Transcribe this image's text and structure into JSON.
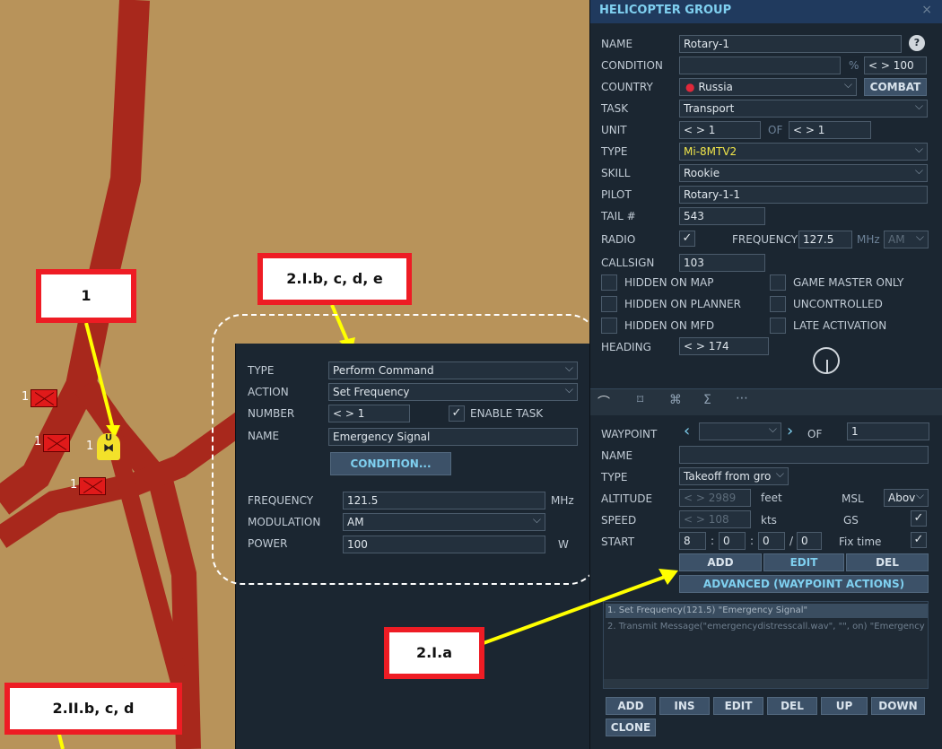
{
  "map": {
    "callouts": [
      "1",
      "2.I.b, c, d, e",
      "2.I.a",
      "2.II.b, c, d"
    ],
    "unit_counts": [
      "1",
      "1",
      "1",
      "1"
    ],
    "helo_letter": "U"
  },
  "trigger": {
    "type_label": "TYPE",
    "type_value": "Perform Command",
    "action_label": "ACTION",
    "action_value": "Set Frequency",
    "number_label": "NUMBER",
    "number_value": "< > 1",
    "enable_task": "ENABLE TASK",
    "name_label": "NAME",
    "name_value": "Emergency Signal",
    "condition_button": "CONDITION...",
    "frequency_label": "FREQUENCY",
    "frequency_value": "121.5",
    "frequency_unit": "MHz",
    "modulation_label": "MODULATION",
    "modulation_value": "AM",
    "power_label": "POWER",
    "power_value": "100",
    "power_unit": "W"
  },
  "group": {
    "title": "HELICOPTER GROUP",
    "close": "×",
    "name_label": "NAME",
    "name_value": "Rotary-1",
    "help": "?",
    "condition_label": "CONDITION",
    "condition_value": "",
    "percent": "%",
    "condition_pct": "< > 100",
    "country_label": "COUNTRY",
    "country_value": "Russia",
    "combat_button": "COMBAT",
    "task_label": "TASK",
    "task_value": "Transport",
    "unit_label": "UNIT",
    "unit_value": "< > 1",
    "of": "OF",
    "unit_of_value": "< > 1",
    "type_label": "TYPE",
    "type_value": "Mi-8MTV2",
    "skill_label": "SKILL",
    "skill_value": "Rookie",
    "pilot_label": "PILOT",
    "pilot_value": "Rotary-1-1",
    "tail_label": "TAIL #",
    "tail_value": "543",
    "radio_label": "RADIO",
    "frequency_label": "FREQUENCY",
    "frequency_value": "127.5",
    "mhz": "MHz",
    "modulation": "AM",
    "callsign_label": "CALLSIGN",
    "callsign_value": "103",
    "hidden_map": "HIDDEN ON MAP",
    "game_master": "GAME MASTER ONLY",
    "hidden_planner": "HIDDEN ON PLANNER",
    "uncontrolled": "UNCONTROLLED",
    "hidden_mfd": "HIDDEN ON MFD",
    "late_activation": "LATE ACTIVATION",
    "heading_label": "HEADING",
    "heading_value": "< > 174"
  },
  "waypoint": {
    "waypoint_label": "WAYPOINT",
    "of": "OF",
    "of_value": "1",
    "name_label": "NAME",
    "type_label": "TYPE",
    "type_value": "Takeoff from gro",
    "altitude_label": "ALTITUDE",
    "altitude_value": "< > 2989",
    "altitude_unit": "feet",
    "alt_ref": "MSL",
    "alt_mode": "Abov",
    "speed_label": "SPEED",
    "speed_value": "< > 108",
    "speed_unit": "kts",
    "gs": "GS",
    "start_label": "START",
    "start_h": "8",
    "start_m": "0",
    "start_s": "0",
    "start_d": "0",
    "fix_time": "Fix time",
    "add": "ADD",
    "edit": "EDIT",
    "del": "DEL",
    "advanced": "ADVANCED (WAYPOINT ACTIONS)",
    "actions": [
      "1. Set Frequency(121.5) \"Emergency Signal\"",
      "2. Transmit Message(\"emergencydistresscall.wav\", \"\", on) \"Emergency S"
    ],
    "bottom_buttons": [
      "ADD",
      "INS",
      "EDIT",
      "DEL",
      "UP",
      "DOWN",
      "CLONE"
    ]
  },
  "colors": {
    "accent": "#7fd0f0",
    "callout_border": "#ee1c24",
    "arrow": "#ffff00",
    "road": "#a8281c",
    "terrain": "#b8935a"
  }
}
